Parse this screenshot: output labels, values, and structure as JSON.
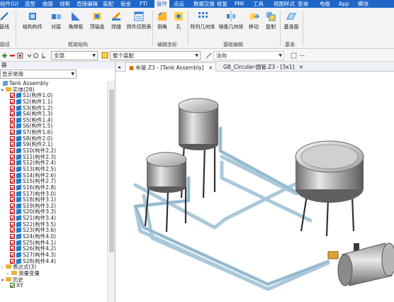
{
  "menubar": {
    "tabs": [
      "组件(U)",
      "造型",
      "曲面",
      "线框",
      "直接编辑",
      "装配",
      "钣金",
      "FTI",
      "管件",
      "点云",
      "数据交换",
      "修复",
      "PMI",
      "工具",
      "视图样式",
      "查询",
      "电极",
      "App",
      "模块"
    ],
    "active": "管件",
    "bg_color": "#1e66c8"
  },
  "ribbon": {
    "left_cut": {
      "label": "直线",
      "group": "路径"
    },
    "buttons": [
      {
        "label": "结构构件",
        "icon": "structure-member-icon"
      },
      {
        "label": "对接",
        "icon": "butt-joint-icon"
      },
      {
        "label": "角撑板",
        "icon": "gusset-icon"
      },
      {
        "label": "顶端盖",
        "icon": "end-cap-icon"
      },
      {
        "label": "焊缝",
        "icon": "weld-icon"
      },
      {
        "label": "焊件切割表",
        "icon": "weld-cutlist-icon"
      },
      {
        "label": "倒角",
        "icon": "chamfer-icon"
      },
      {
        "label": "孔",
        "icon": "hole-icon"
      },
      {
        "label": "阵列几何体",
        "icon": "pattern-geometry-icon"
      },
      {
        "label": "镜像几何体",
        "icon": "mirror-geometry-icon"
      },
      {
        "label": "移动",
        "icon": "move-icon"
      },
      {
        "label": "复制",
        "icon": "copy-icon"
      },
      {
        "label": "基准面",
        "icon": "datum-plane-icon"
      }
    ],
    "groups": [
      "框架结构",
      "编辑坐标",
      "基础编辑",
      "基准"
    ]
  },
  "toolbar": {
    "filter_value": "全部",
    "assembly_value": "整个装配",
    "normal_value": "法向"
  },
  "left_panel": {
    "title": "器",
    "filter_value": "显示常用",
    "root": "Tank Assembly",
    "entities_label": "实体(28)",
    "parts": [
      "S1(构件1.0)",
      "S2(构件1.1)",
      "S3(构件1.2)",
      "S4(构件1.3)",
      "S5(构件1.4)",
      "S6(构件1.5)",
      "S7(构件1.6)",
      "S8(构件2.0)",
      "S9(构件2.1)",
      "S10(构件2.2)",
      "S11(构件2.3)",
      "S12(构件2.4)",
      "S13(构件2.5)",
      "S14(构件2.6)",
      "S15(构件2.7)",
      "S16(构件2.8)",
      "S17(构件3.0)",
      "S18(构件3.1)",
      "S19(构件3.2)",
      "S20(构件3.3)",
      "S21(构件3.4)",
      "S22(构件3.5)",
      "S23(构件3.6)",
      "S24(构件4.0)",
      "S25(构件4.1)",
      "S26(构件4.2)",
      "S27(构件4.3)",
      "S28(构件4.4)"
    ],
    "expressions_label": "表达式(3)",
    "variables_label": "测量变量",
    "history_label": "历史",
    "last_item": "XY"
  },
  "doc_tabs": [
    {
      "label": "布管.Z3 - [Tank Assembly]",
      "close": "×"
    },
    {
      "label": "GB_Circular-圆管.Z3 - [3x1]",
      "close": "×"
    }
  ]
}
